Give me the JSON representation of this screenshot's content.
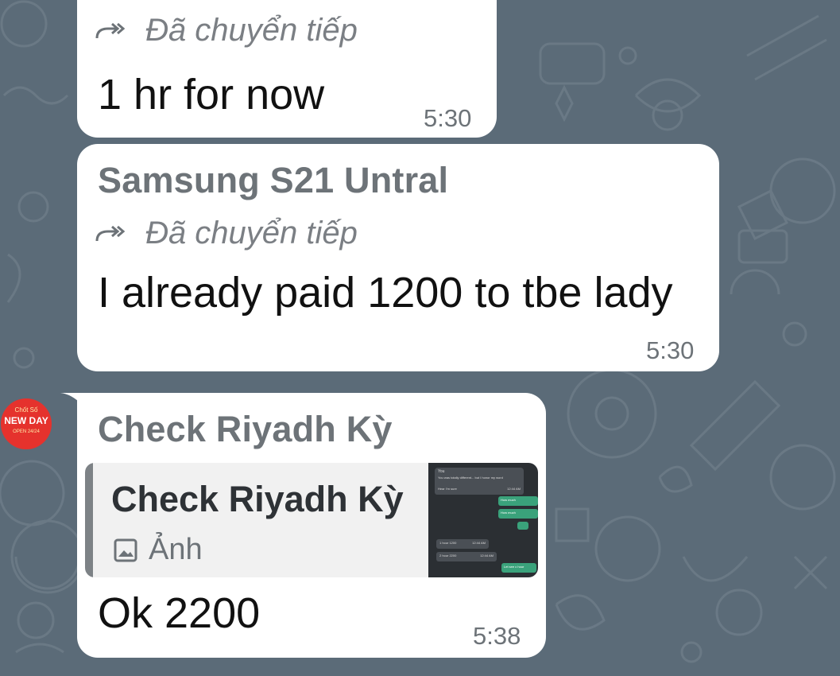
{
  "colors": {
    "wallpaper": "#5b6b78",
    "bubble": "#ffffff",
    "secondary_text": "#6d7378",
    "avatar_red": "#e5322d"
  },
  "messages": [
    {
      "forwarded_label": "Đã chuyển tiếp",
      "text": "1 hr for now",
      "time": "5:30"
    },
    {
      "sender": "Samsung S21 Untral",
      "forwarded_label": "Đã chuyển tiếp",
      "text": "I already paid 1200 to tbe lady",
      "time": "5:30"
    },
    {
      "sender": "Check Riyadh Kỳ",
      "avatar": {
        "line1": "Chốt Số",
        "line2": "NEW DAY",
        "line3": "OPEN 24/24"
      },
      "reply": {
        "name": "Check Riyadh Kỳ",
        "media_label": "Ảnh",
        "media_icon": "image-icon",
        "thumbnail": {
          "header_line1": "You",
          "header_line2": "You was totally different... but I honor my word",
          "lines_left": [
            "Hear I'm sure",
            "1 hour 1200",
            "2 hour 2200"
          ],
          "lines_right": [
            "How much",
            "How much",
            "Let see c hour"
          ],
          "times": [
            "12:44 AM",
            "12:44 AM",
            "12:44 AM"
          ]
        }
      },
      "text": "Ok 2200",
      "time": "5:38"
    }
  ],
  "icons": {
    "forward": "forward-arrow-icon",
    "image": "image-icon"
  }
}
